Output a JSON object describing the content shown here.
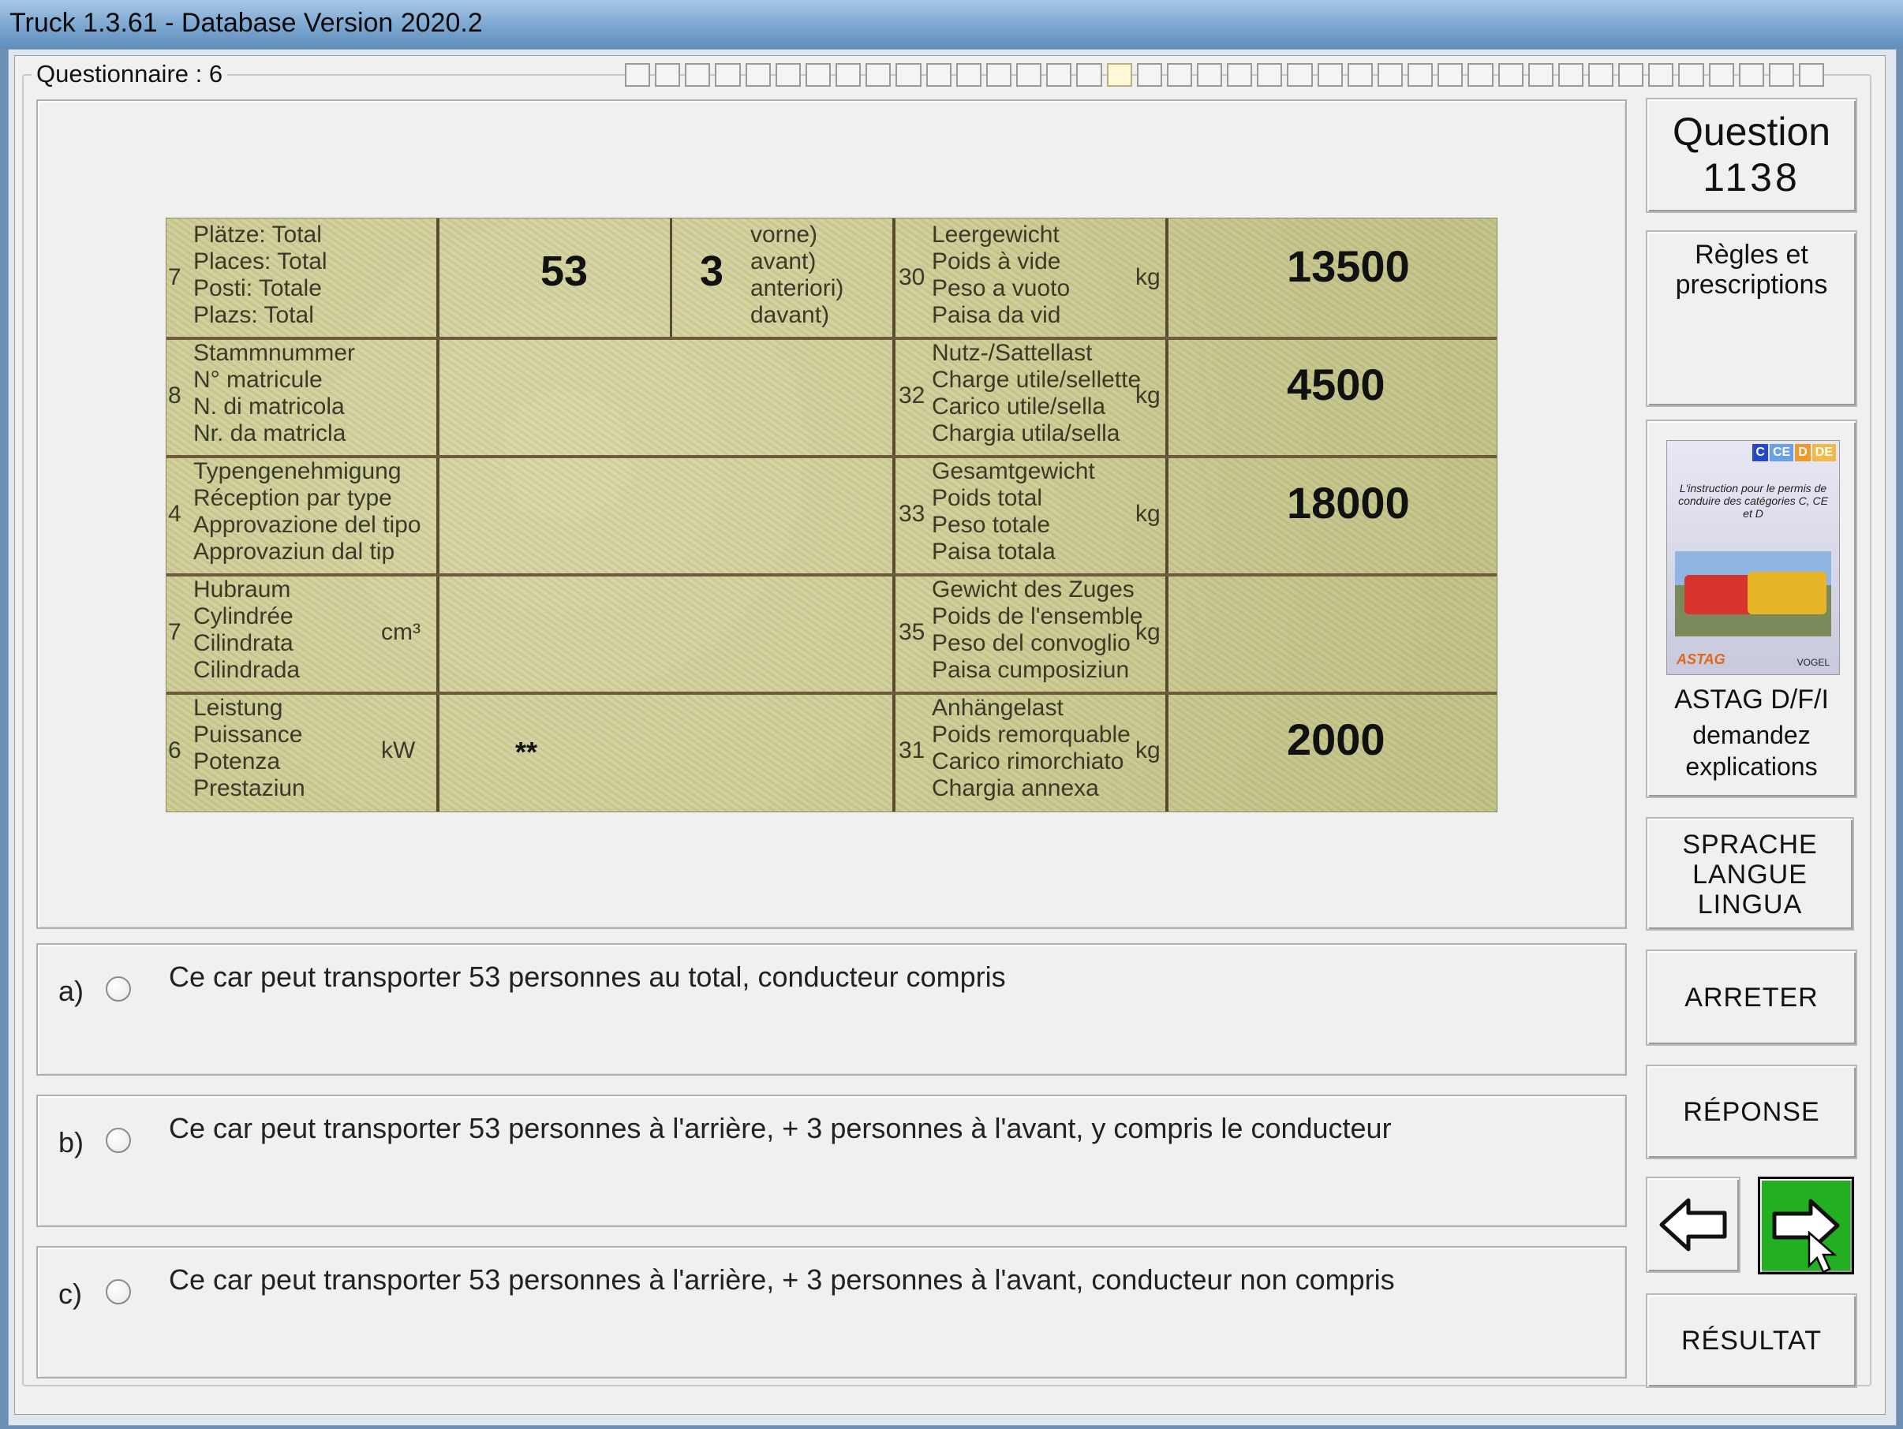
{
  "window": {
    "title": "Truck 1.3.61 - Database Version 2020.2"
  },
  "questionnaire": {
    "label": "Questionnaire : 6",
    "progress_cells": 40,
    "current_cell": 16
  },
  "document": {
    "rows": [
      {
        "num": "7",
        "labels": [
          "Plätze:     Total",
          "Places:     Total",
          "Posti:       Totale",
          "Plazs:       Total"
        ],
        "value1": "53",
        "value2": "3",
        "labels2": [
          "vorne)",
          "avant)",
          "anteriori)",
          "davant)"
        ],
        "num_r": "30",
        "labels_r": [
          "Leergewicht",
          "Poids à vide",
          "Peso a vuoto",
          "Paisa da vid"
        ],
        "unit_r": "kg",
        "value_r": "13500"
      },
      {
        "num": "8",
        "labels": [
          "Stammnummer",
          "N° matricule",
          "N. di matricola",
          "Nr. da matricla"
        ],
        "num_r": "32",
        "labels_r": [
          "Nutz-/Sattellast",
          "Charge utile/sellette",
          "Carico utile/sella",
          "Chargia utila/sella"
        ],
        "unit_r": "kg",
        "value_r": "4500"
      },
      {
        "num": "4",
        "labels": [
          "Typengenehmigung",
          "Réception par type",
          "Approvazione del tipo",
          "Approvaziun dal tip"
        ],
        "num_r": "33",
        "labels_r": [
          "Gesamtgewicht",
          "Poids total",
          "Peso totale",
          "Paisa totala"
        ],
        "unit_r": "kg",
        "value_r": "18000"
      },
      {
        "num": "7",
        "labels": [
          "Hubraum",
          "Cylindrée",
          "Cilindrata",
          "Cilindrada"
        ],
        "unit": "cm³",
        "num_r": "35",
        "labels_r": [
          "Gewicht des Zuges",
          "Poids de l'ensemble",
          "Peso del convoglio",
          "Paisa cumposiziun"
        ],
        "unit_r": "kg",
        "value_r": ""
      },
      {
        "num": "6",
        "labels": [
          "Leistung",
          "Puissance",
          "Potenza",
          "Prestaziun"
        ],
        "unit": "kW",
        "value1": "**",
        "num_r": "31",
        "labels_r": [
          "Anhängelast",
          "Poids remorquable",
          "Carico rimorchiato",
          "Chargia annexa"
        ],
        "unit_r": "kg",
        "value_r": "2000"
      }
    ]
  },
  "answers": [
    {
      "letter": "a)",
      "text": "Ce car peut transporter 53 personnes au total, conducteur compris"
    },
    {
      "letter": "b)",
      "text": "Ce car peut transporter 53 personnes à l'arrière, + 3 personnes à l'avant, y compris le conducteur"
    },
    {
      "letter": "c)",
      "text": "Ce car peut transporter 53 personnes à l'arrière, + 3 personnes à l'avant, conducteur non compris"
    }
  ],
  "sidebar": {
    "question_label": "Question",
    "question_number": "1138",
    "regles_line1": "Règles et",
    "regles_line2": "prescriptions",
    "book_tags": [
      "C",
      "CE",
      "D",
      "DE"
    ],
    "book_text": "L'instruction pour le permis de conduire des catégories C, CE et D",
    "book_logo1": "ASTAG",
    "book_logo2": "VOGEL",
    "astag_title": "ASTAG D/F/I",
    "astag_line1": "demandez",
    "astag_line2": "explications",
    "lang_line1": "SPRACHE",
    "lang_line2": "LANGUE",
    "lang_line3": "LINGUA",
    "stop_label": "ARRETER",
    "answer_label": "RÉPONSE",
    "result_label": "RÉSULTAT"
  },
  "colors": {
    "next_button": "#22b022",
    "document_bg": "#cfcd97"
  }
}
